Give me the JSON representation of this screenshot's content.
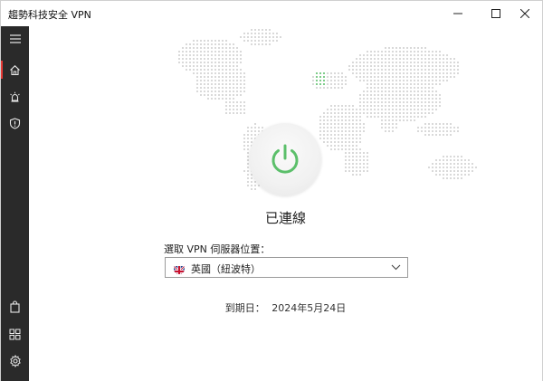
{
  "window": {
    "title": "趨勢科技安全 VPN",
    "minimize_icon": "minimize-icon",
    "maximize_icon": "maximize-icon",
    "close_icon": "close-icon"
  },
  "sidebar": {
    "items": [
      {
        "icon": "hamburger-menu-icon"
      },
      {
        "icon": "home-icon",
        "active": true
      },
      {
        "icon": "alert-bell-icon"
      },
      {
        "icon": "shield-icon"
      },
      {
        "icon": "shopping-bag-icon"
      },
      {
        "icon": "grid-apps-icon"
      },
      {
        "icon": "settings-gear-icon"
      }
    ]
  },
  "main": {
    "status": "已連線",
    "power_icon": "power-icon",
    "location_label": "選取 VPN 伺服器位置：",
    "location_value": "英國（紐波特）",
    "location_flag_icon": "uk-flag-icon",
    "expiry_label": "到期日：",
    "expiry_date": "2024年5月24日"
  },
  "colors": {
    "sidebar_bg": "#2a2a2a",
    "accent_red": "#e53935",
    "connected_green": "#5bbf6a",
    "map_dot": "#cfcfcf",
    "map_highlight": "#5bbf6a"
  }
}
